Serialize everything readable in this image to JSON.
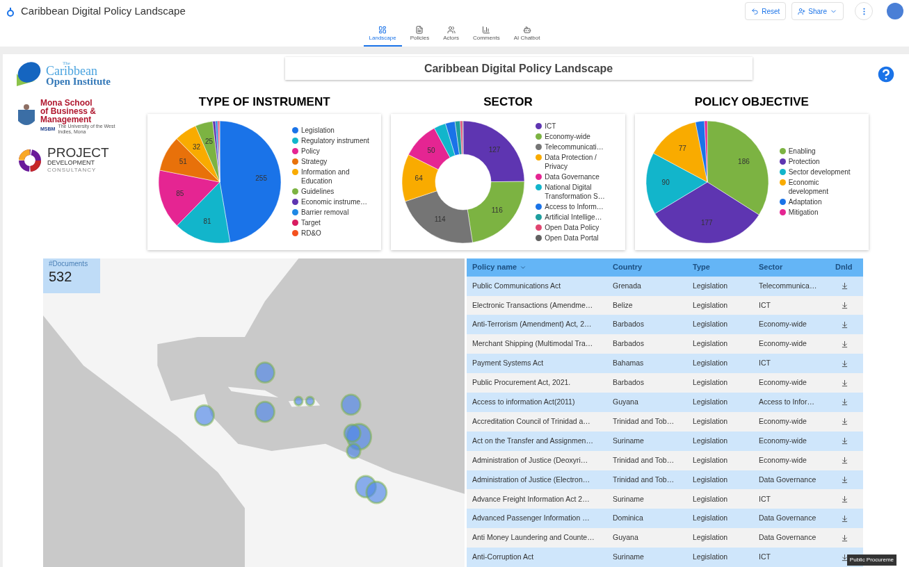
{
  "app": {
    "title": "Caribbean Digital Policy Landscape",
    "actions": [
      {
        "label": "Reset",
        "kind": "reset"
      },
      {
        "label": "Share",
        "kind": "share"
      }
    ]
  },
  "tabs": [
    {
      "label": "Landscape",
      "selected": true,
      "kind": "layout"
    },
    {
      "label": "Policies",
      "selected": false,
      "kind": "doc"
    },
    {
      "label": "Actors",
      "selected": false,
      "kind": "people"
    },
    {
      "label": "Comments",
      "selected": false,
      "kind": "bars"
    },
    {
      "label": "AI Chatbot",
      "selected": false,
      "kind": "bot"
    }
  ],
  "logos": {
    "coi": {
      "small": "The",
      "line1": "Caribbean",
      "line2a": "Open",
      "line2b": "Institute"
    },
    "mona": {
      "lines": [
        "Mona School",
        "of Business &",
        "Management"
      ],
      "abbr": "MSBM",
      "tagline": "The University of the West Indies, Mona"
    },
    "pdc": {
      "line1": "PROJECT",
      "line2": "DEVELOPMENT",
      "line3": "CONSULTANCY"
    }
  },
  "page_title": "Caribbean Digital Policy Landscape",
  "charts": [
    {
      "chart_data": {
        "type": "pie",
        "title": "TYPE OF INSTRUMENT",
        "categories": [
          "Legislation",
          "Regulatory instrument",
          "Policy",
          "Strategy",
          "Information and Education",
          "Guidelines",
          "Economic instrume…",
          "Barrier removal",
          "Target",
          "RD&O"
        ],
        "values": [
          255,
          81,
          85,
          51,
          32,
          25,
          4,
          3,
          2,
          1
        ],
        "value_labels": [
          "255",
          "81",
          "85",
          "51",
          "32",
          "25",
          null,
          null,
          null,
          null
        ],
        "legend": "right"
      }
    },
    {
      "chart_data": {
        "type": "donut",
        "title": "SECTOR",
        "categories": [
          "ICT",
          "Economy-wide",
          "Telecommunicati…",
          "Data Protection / Privacy",
          "Data Governance",
          "National Digital Transformation S…",
          "Access to Inform…",
          "Artificial Intellige…",
          "Open Data Policy",
          "Open Data Portal"
        ],
        "values": [
          127,
          116,
          114,
          64,
          50,
          16,
          13,
          7,
          3,
          1
        ],
        "value_labels": [
          "127",
          "116",
          "114",
          "64",
          "50",
          null,
          null,
          null,
          null,
          null
        ],
        "legend": "right"
      }
    },
    {
      "chart_data": {
        "type": "pie",
        "title": "POLICY OBJECTIVE",
        "categories": [
          "Enabling",
          "Protection",
          "Sector development",
          "Economic development",
          "Adaptation",
          "Mitigation"
        ],
        "values": [
          186,
          177,
          90,
          77,
          13,
          4
        ],
        "value_labels": [
          "186",
          "177",
          "90",
          "77",
          null,
          null
        ],
        "legend": "right"
      }
    }
  ],
  "documents": {
    "label": "#Documents",
    "count": "532"
  },
  "table": {
    "columns": [
      {
        "label": "Policy name",
        "sorted": true
      },
      {
        "label": "Country",
        "sorted": false
      },
      {
        "label": "Type",
        "sorted": false
      },
      {
        "label": "Sector",
        "sorted": false
      },
      {
        "label": "Dnld",
        "sorted": false
      }
    ],
    "rows": [
      [
        "Public Communications Act",
        "Grenada",
        "Legislation",
        "Telecommunica…"
      ],
      [
        "Electronic Transactions (Amendme…",
        "Belize",
        "Legislation",
        "ICT"
      ],
      [
        "Anti-Terrorism (Amendment) Act, 2…",
        "Barbados",
        "Legislation",
        "Economy-wide"
      ],
      [
        "Merchant Shipping (Multimodal Tra…",
        "Barbados",
        "Legislation",
        "Economy-wide"
      ],
      [
        "Payment Systems Act",
        "Bahamas",
        "Legislation",
        "ICT"
      ],
      [
        "Public Procurement Act, 2021.",
        "Barbados",
        "Legislation",
        "Economy-wide"
      ],
      [
        "Access to information Act(2011)",
        "Guyana",
        "Legislation",
        "Access to Infor…"
      ],
      [
        "Accreditation Council of Trinidad a…",
        "Trinidad and Tob…",
        "Legislation",
        "Economy-wide"
      ],
      [
        "Act on the Transfer and Assignmen…",
        "Suriname",
        "Legislation",
        "Economy-wide"
      ],
      [
        "Administration of Justice (Deoxyri…",
        "Trinidad and Tob…",
        "Legislation",
        "Economy-wide"
      ],
      [
        "Administration of Justice (Electron…",
        "Trinidad and Tob…",
        "Legislation",
        "Data Governance"
      ],
      [
        "Advance Freight Information Act 2…",
        "Suriname",
        "Legislation",
        "ICT"
      ],
      [
        "Advanced Passenger Information …",
        "Dominica",
        "Legislation",
        "Data Governance"
      ],
      [
        "Anti Money Laundering and Counte…",
        "Guyana",
        "Legislation",
        "Data Governance"
      ],
      [
        "Anti-Corruption Act",
        "Suriname",
        "Legislation",
        "ICT"
      ]
    ]
  },
  "tooltip": "Public Procureme"
}
